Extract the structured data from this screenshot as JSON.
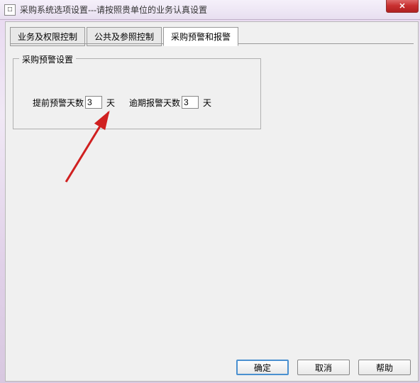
{
  "titlebar": {
    "icon_char": "□",
    "title": "采购系统选项设置---请按照贵单位的业务认真设置",
    "close": "✕"
  },
  "tabs": {
    "items": [
      {
        "label": "业务及权限控制"
      },
      {
        "label": "公共及参照控制"
      },
      {
        "label": "采购预警和报警"
      }
    ]
  },
  "group": {
    "legend": "采购预警设置",
    "advance": {
      "label": "提前预警天数",
      "value": "3",
      "unit": "天"
    },
    "overdue": {
      "label": "逾期报警天数",
      "value": "3",
      "unit": "天"
    }
  },
  "buttons": {
    "ok": "确定",
    "cancel": "取消",
    "help": "帮助"
  }
}
